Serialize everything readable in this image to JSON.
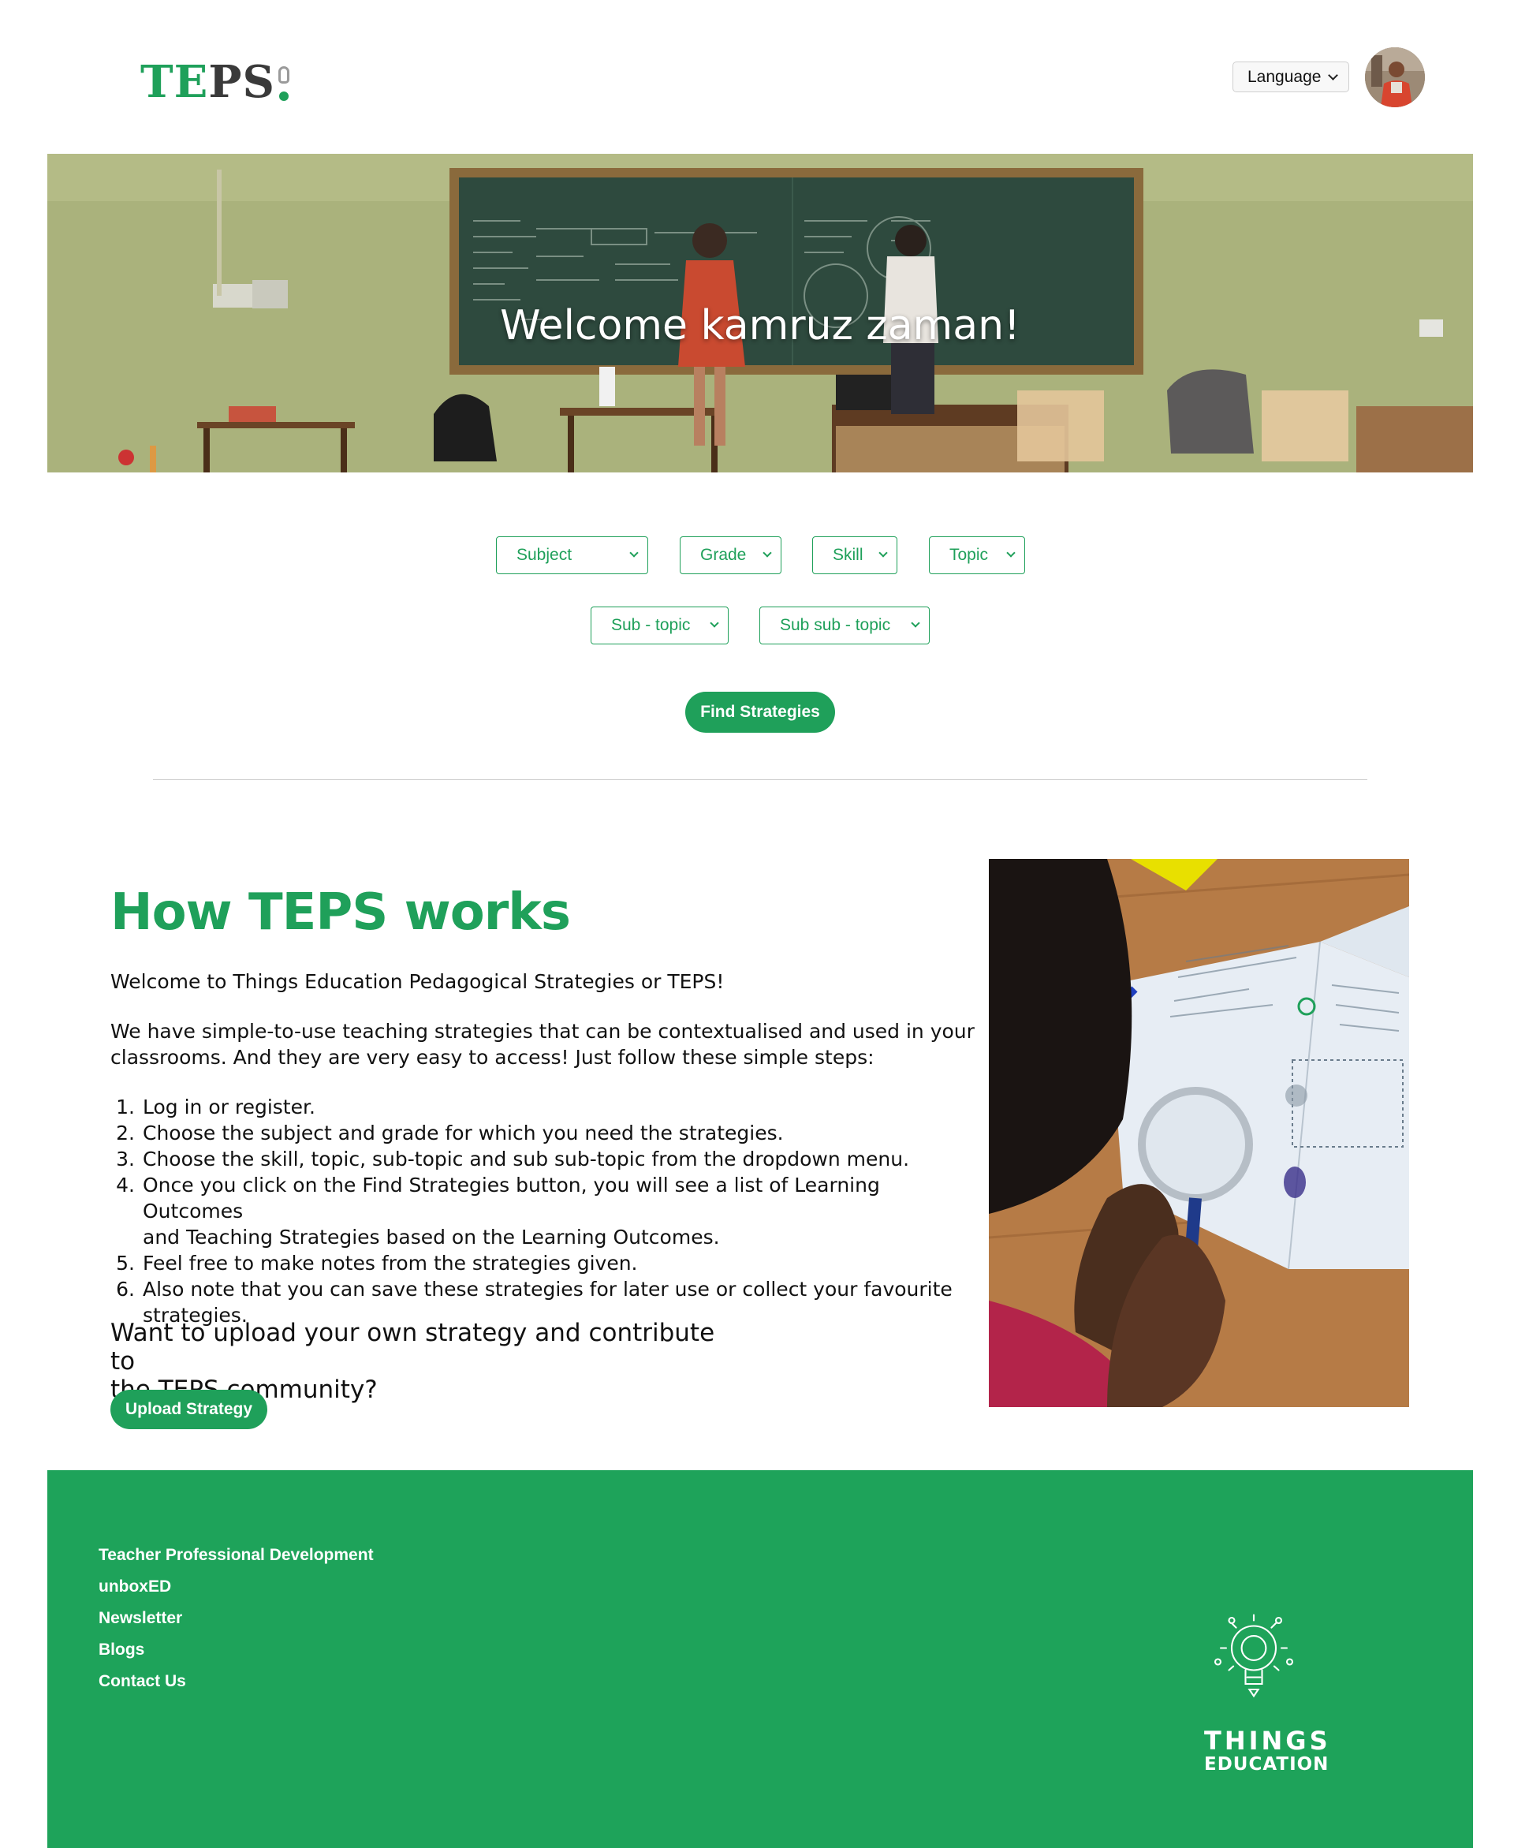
{
  "header": {
    "logo_text": "TEPS",
    "language_label": "Language"
  },
  "hero": {
    "title": "Welcome kamruz zaman!"
  },
  "filters": {
    "subject": "Subject",
    "grade": "Grade",
    "skill": "Skill",
    "topic": "Topic",
    "sub_topic": "Sub - topic",
    "sub_sub_topic": "Sub sub - topic",
    "find_button": "Find Strategies"
  },
  "how": {
    "title": "How TEPS works",
    "intro": "Welcome to Things Education Pedagogical Strategies or TEPS!",
    "para_line1": "We have simple-to-use teaching strategies that can be contextualised and used in your",
    "para_line2": "classrooms. And they are very easy to access! Just follow these simple steps:",
    "steps": [
      {
        "num": "1.",
        "lines": [
          "Log in or register."
        ]
      },
      {
        "num": "2.",
        "lines": [
          "Choose the subject and grade for which you need the strategies."
        ]
      },
      {
        "num": "3.",
        "lines": [
          "Choose the skill, topic, sub-topic and sub sub-topic from the dropdown menu."
        ]
      },
      {
        "num": "4.",
        "lines": [
          "Once you click on the Find Strategies button, you will see a list of Learning Outcomes",
          "and Teaching Strategies based on the Learning Outcomes."
        ]
      },
      {
        "num": "5.",
        "lines": [
          "Feel free to make notes from the strategies given."
        ]
      },
      {
        "num": "6.",
        "lines": [
          "Also note that you can save these strategies for later use or collect your favourite",
          "strategies."
        ]
      }
    ],
    "upload_question_line1": "Want to upload your own strategy and contribute to",
    "upload_question_line2": "the TEPS community?",
    "upload_button": "Upload Strategy"
  },
  "footer": {
    "links": [
      "Teacher Professional Development",
      "unboxED",
      "Newsletter",
      "Blogs",
      "Contact Us"
    ],
    "brand_line1": "THINGS",
    "brand_line2": "EDUCATION"
  },
  "colors": {
    "brand_green": "#1fa05a",
    "footer_green": "#1ea35a"
  }
}
